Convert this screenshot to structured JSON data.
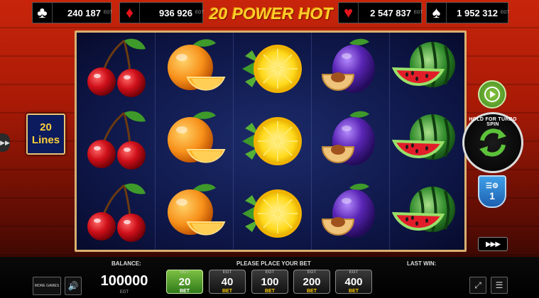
{
  "game": {
    "title": "20 POWER HOT"
  },
  "jackpots": [
    {
      "suit": "clubs",
      "symbol": "♣",
      "amount": "240 187",
      "color": "#ffffff",
      "brand": "EGT"
    },
    {
      "suit": "diamonds",
      "symbol": "♦",
      "amount": "936 926",
      "color": "#e3141b",
      "brand": "EGT"
    },
    {
      "suit": "hearts",
      "symbol": "♥",
      "amount": "2 547 837",
      "color": "#e3141b",
      "brand": "EGT"
    },
    {
      "suit": "spades",
      "symbol": "♠",
      "amount": "1 952 312",
      "color": "#ffffff",
      "brand": "EGT"
    }
  ],
  "reels": {
    "columns": [
      [
        "cherry",
        "cherry",
        "cherry"
      ],
      [
        "orange",
        "orange",
        "orange"
      ],
      [
        "lemon",
        "lemon",
        "lemon"
      ],
      [
        "plum",
        "plum",
        "plum"
      ],
      [
        "watermelon",
        "watermelon",
        "watermelon"
      ]
    ]
  },
  "lines": {
    "count": "20",
    "label": "Lines"
  },
  "controls": {
    "autoplay_icon": "play-icon",
    "spin_caption": "HOLD FOR TURBO SPIN",
    "spin_icon": "refresh-arrows-icon",
    "turbo_value": "1",
    "turbo_icon": "settings-list-icon",
    "fast_forward": "▶▶▶"
  },
  "bottom": {
    "balance_label": "BALANCE:",
    "balance_value": "100000",
    "balance_brand": "EGT",
    "bet_prompt": "PLEASE PLACE YOUR BET",
    "last_win_label": "LAST WIN:",
    "more_games_label": "MORE GAMES",
    "bets": [
      {
        "brand": "EGT",
        "value": "20",
        "label": "BET",
        "active": true
      },
      {
        "brand": "EGT",
        "value": "40",
        "label": "BET",
        "active": false
      },
      {
        "brand": "EGT",
        "value": "100",
        "label": "BET",
        "active": false
      },
      {
        "brand": "EGT",
        "value": "200",
        "label": "BET",
        "active": false
      },
      {
        "brand": "EGT",
        "value": "400",
        "label": "BET",
        "active": false
      }
    ]
  },
  "colors": {
    "accent_gold": "#ffcf2a",
    "active_bet_green": "#5da832",
    "reel_frame": "#d9b070"
  }
}
